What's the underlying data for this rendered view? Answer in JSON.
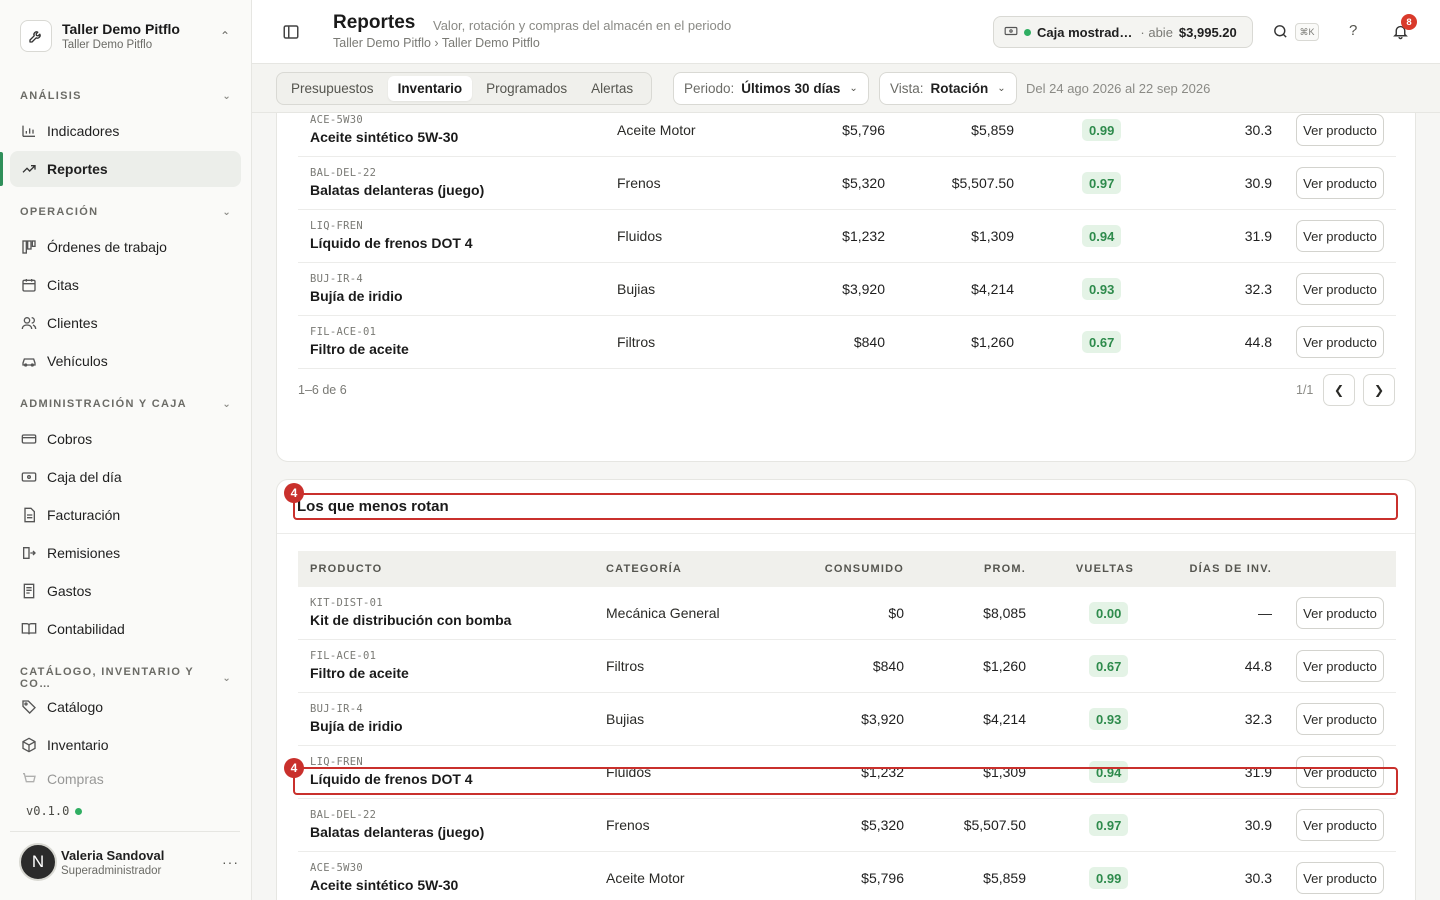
{
  "org": {
    "name": "Taller Demo Pitflo",
    "sub": "Taller Demo Pitflo"
  },
  "sidebar": {
    "sections": [
      {
        "title": "ANÁLISIS",
        "items": [
          {
            "label": "Indicadores",
            "icon": "gauge-icon"
          },
          {
            "label": "Reportes",
            "icon": "trend-icon",
            "active": true
          }
        ]
      },
      {
        "title": "OPERACIÓN",
        "items": [
          {
            "label": "Órdenes de trabajo",
            "icon": "kanban-icon"
          },
          {
            "label": "Citas",
            "icon": "calendar-icon"
          },
          {
            "label": "Clientes",
            "icon": "users-icon"
          },
          {
            "label": "Vehículos",
            "icon": "car-icon"
          }
        ]
      },
      {
        "title": "ADMINISTRACIÓN Y CAJA",
        "items": [
          {
            "label": "Cobros",
            "icon": "cash-icon"
          },
          {
            "label": "Caja del día",
            "icon": "wallet-icon"
          },
          {
            "label": "Facturación",
            "icon": "document-icon"
          },
          {
            "label": "Remisiones",
            "icon": "export-icon"
          },
          {
            "label": "Gastos",
            "icon": "receipt-icon"
          },
          {
            "label": "Contabilidad",
            "icon": "book-icon"
          }
        ]
      },
      {
        "title": "CATÁLOGO, INVENTARIO Y CO…",
        "items": [
          {
            "label": "Catálogo",
            "icon": "tag-icon"
          },
          {
            "label": "Inventario",
            "icon": "box-icon"
          },
          {
            "label": "Compras",
            "icon": "cart-icon"
          }
        ]
      }
    ],
    "version": "v0.1.0",
    "user": {
      "initial": "N",
      "name": "Valeria Sandoval",
      "role": "Superadministrador"
    }
  },
  "header": {
    "title": "Reportes",
    "description": "Valor, rotación y compras del almacén en el periodo",
    "breadcrumb": "Taller Demo Pitflo › Taller Demo Pitflo",
    "caja": {
      "name": "Caja mostrad…",
      "separator": "·",
      "state": "abie",
      "amount": "$3,995.20"
    },
    "shortcut": "⌘K",
    "help": "?",
    "notifications": "8"
  },
  "toolbar": {
    "tabs": [
      {
        "label": "Presupuestos"
      },
      {
        "label": "Inventario",
        "active": true
      },
      {
        "label": "Programados"
      },
      {
        "label": "Alertas"
      }
    ],
    "periodo": {
      "label": "Periodo:",
      "value": "Últimos 30 días"
    },
    "vista": {
      "label": "Vista:",
      "value": "Rotación"
    },
    "range": "Del 24 ago 2026 al 22 sep 2026"
  },
  "top_table": {
    "rows": [
      {
        "sku": "ACE-5W30",
        "name": "Aceite sintético 5W-30",
        "category": "Aceite Motor",
        "consumed": "$5,796",
        "avg": "$5,859",
        "turns": "0.99",
        "days": "30.3",
        "action": "Ver producto"
      },
      {
        "sku": "BAL-DEL-22",
        "name": "Balatas delanteras (juego)",
        "category": "Frenos",
        "consumed": "$5,320",
        "avg": "$5,507.50",
        "turns": "0.97",
        "days": "30.9",
        "action": "Ver producto"
      },
      {
        "sku": "LIQ-FREN",
        "name": "Líquido de frenos DOT 4",
        "category": "Fluidos",
        "consumed": "$1,232",
        "avg": "$1,309",
        "turns": "0.94",
        "days": "31.9",
        "action": "Ver producto"
      },
      {
        "sku": "BUJ-IR-4",
        "name": "Bujía de iridio",
        "category": "Bujias",
        "consumed": "$3,920",
        "avg": "$4,214",
        "turns": "0.93",
        "days": "32.3",
        "action": "Ver producto"
      },
      {
        "sku": "FIL-ACE-01",
        "name": "Filtro de aceite",
        "category": "Filtros",
        "consumed": "$840",
        "avg": "$1,260",
        "turns": "0.67",
        "days": "44.8",
        "action": "Ver producto"
      }
    ],
    "pager_info": "1–6 de 6",
    "pager_page": "1/1"
  },
  "least_rotated": {
    "title": "Los que menos rotan",
    "columns": {
      "product": "PRODUCTO",
      "category": "CATEGORÍA",
      "consumed": "CONSUMIDO",
      "avg": "PROM.",
      "turns": "VUELTAS",
      "days": "DÍAS DE INV."
    },
    "rows": [
      {
        "sku": "KIT-DIST-01",
        "name": "Kit de distribución con bomba",
        "category": "Mecánica General",
        "consumed": "$0",
        "avg": "$8,085",
        "turns": "0.00",
        "days": "—",
        "action": "Ver producto"
      },
      {
        "sku": "FIL-ACE-01",
        "name": "Filtro de aceite",
        "category": "Filtros",
        "consumed": "$840",
        "avg": "$1,260",
        "turns": "0.67",
        "days": "44.8",
        "action": "Ver producto"
      },
      {
        "sku": "BUJ-IR-4",
        "name": "Bujía de iridio",
        "category": "Bujias",
        "consumed": "$3,920",
        "avg": "$4,214",
        "turns": "0.93",
        "days": "32.3",
        "action": "Ver producto"
      },
      {
        "sku": "LIQ-FREN",
        "name": "Líquido de frenos DOT 4",
        "category": "Fluidos",
        "consumed": "$1,232",
        "avg": "$1,309",
        "turns": "0.94",
        "days": "31.9",
        "action": "Ver producto"
      },
      {
        "sku": "BAL-DEL-22",
        "name": "Balatas delanteras (juego)",
        "category": "Frenos",
        "consumed": "$5,320",
        "avg": "$5,507.50",
        "turns": "0.97",
        "days": "30.9",
        "action": "Ver producto"
      },
      {
        "sku": "ACE-5W30",
        "name": "Aceite sintético 5W-30",
        "category": "Aceite Motor",
        "consumed": "$5,796",
        "avg": "$5,859",
        "turns": "0.99",
        "days": "30.3",
        "action": "Ver producto"
      }
    ]
  },
  "annotations": [
    {
      "label": "4"
    },
    {
      "label": "4"
    }
  ],
  "colors": {
    "accent": "#2f8f5a",
    "pill_bg": "#e4f3e6",
    "pill_text": "#2e8b4c",
    "badge": "#d93a2b",
    "annotation": "#c9302c"
  }
}
